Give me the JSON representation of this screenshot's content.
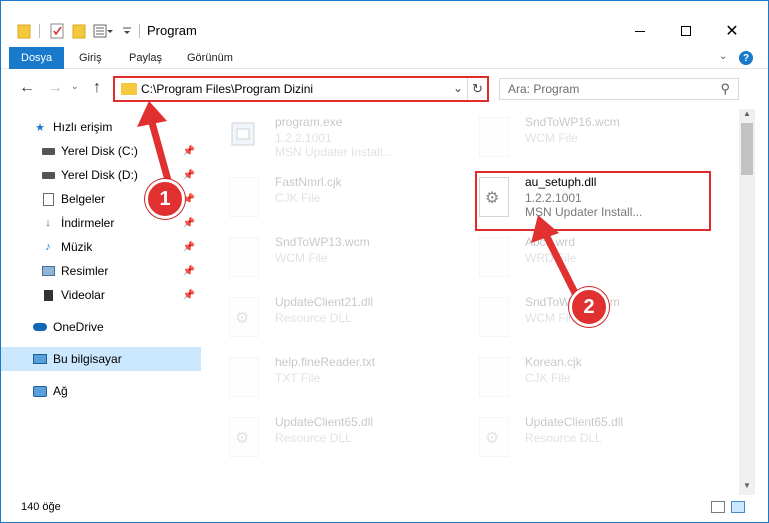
{
  "window": {
    "title": "Program"
  },
  "quick_access_toolbar": [
    "folder-icon",
    "properties-icon",
    "new-folder-icon",
    "customize-icon"
  ],
  "ribbon": {
    "tabs": [
      "Dosya",
      "Giriş",
      "Paylaş",
      "Görünüm"
    ],
    "active_tab": "Dosya"
  },
  "address": {
    "path": "C:\\Program Files\\Program Dizini"
  },
  "search": {
    "placeholder": "Ara: Program"
  },
  "sidebar": {
    "items": [
      {
        "label": "Hızlı erişim",
        "icon": "star-icon",
        "pinned": false
      },
      {
        "label": "Yerel Disk (C:)",
        "icon": "drive-icon",
        "pinned": true
      },
      {
        "label": "Yerel Disk (D:)",
        "icon": "drive-icon",
        "pinned": true
      },
      {
        "label": "Belgeler",
        "icon": "documents-icon",
        "pinned": true
      },
      {
        "label": "İndirmeler",
        "icon": "download-icon",
        "pinned": true
      },
      {
        "label": "Müzik",
        "icon": "music-icon",
        "pinned": true
      },
      {
        "label": "Resimler",
        "icon": "pictures-icon",
        "pinned": true
      },
      {
        "label": "Videolar",
        "icon": "videos-icon",
        "pinned": true
      },
      {
        "label": "OneDrive",
        "icon": "cloud-icon",
        "pinned": false
      },
      {
        "label": "Bu bilgisayar",
        "icon": "computer-icon",
        "pinned": false,
        "selected": true
      },
      {
        "label": "Ağ",
        "icon": "network-icon",
        "pinned": false
      }
    ]
  },
  "files": [
    {
      "name": "program.exe",
      "line1": "1.2.2.1001",
      "line2": "MSN Updater Install...",
      "icon": "program-icon",
      "faded": true
    },
    {
      "name": "SndToWP16.wcm",
      "line1": "WCM File",
      "line2": "",
      "icon": "file-icon",
      "faded": true
    },
    {
      "name": "FastNmrl.cjk",
      "line1": "CJK File",
      "line2": "",
      "icon": "file-icon",
      "faded": true
    },
    {
      "name": "au_setuph.dll",
      "line1": "1.2.2.1001",
      "line2": "MSN Updater Install...",
      "icon": "dll-gear-icon",
      "faded": false
    },
    {
      "name": "SndToWP13.wcm",
      "line1": "WCM File",
      "line2": "",
      "icon": "file-icon",
      "faded": true
    },
    {
      "name": "Abcd.wrd",
      "line1": "WRD File",
      "line2": "",
      "icon": "file-icon",
      "faded": true
    },
    {
      "name": "UpdateClient21.dll",
      "line1": "Resource DLL",
      "line2": "",
      "icon": "dll-gear-icon",
      "faded": true
    },
    {
      "name": "SndToWP15.wcm",
      "line1": "WCM File",
      "line2": "",
      "icon": "file-icon",
      "faded": true
    },
    {
      "name": "help.fineReader.txt",
      "line1": "TXT File",
      "line2": "",
      "icon": "file-icon",
      "faded": true
    },
    {
      "name": "Korean.cjk",
      "line1": "CJK File",
      "line2": "",
      "icon": "file-icon",
      "faded": true
    },
    {
      "name": "UpdateClient65.dll",
      "line1": "Resource DLL",
      "line2": "",
      "icon": "dll-gear-icon",
      "faded": true
    },
    {
      "name": "UpdateClient65.dll",
      "line1": "Resource DLL",
      "line2": "",
      "icon": "dll-gear-icon",
      "faded": true
    }
  ],
  "status": {
    "item_count": "140 öğe"
  },
  "callouts": [
    {
      "number": "1",
      "target": "address-bar"
    },
    {
      "number": "2",
      "target": "au_setuph.dll"
    }
  ],
  "colors": {
    "accent": "#1979ca",
    "highlight": "#e02b2b",
    "selection": "#cce8ff"
  }
}
